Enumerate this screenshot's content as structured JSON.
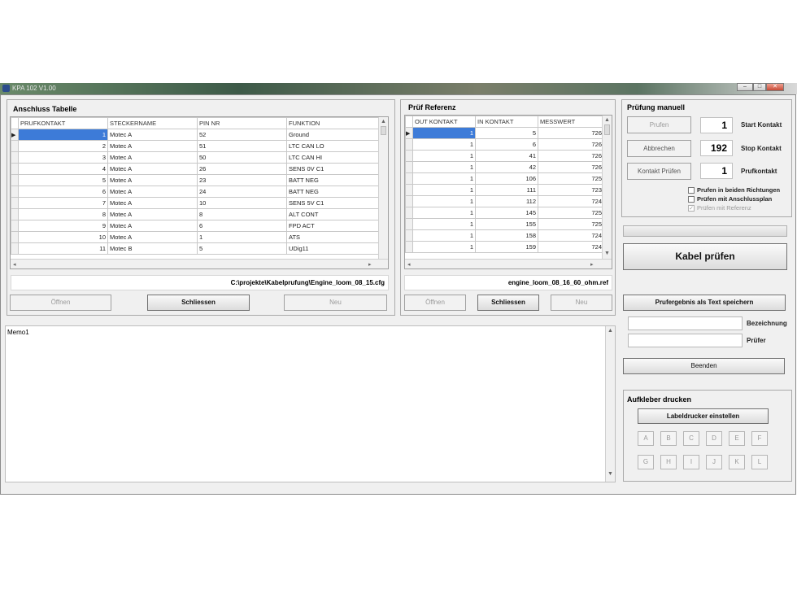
{
  "window": {
    "title": "KPA 102   V1.00",
    "controls": [
      "–",
      "□",
      "✕"
    ]
  },
  "anschluss": {
    "title": "Anschluss Tabelle",
    "columns": [
      "PRUFKONTAKT",
      "STECKERNAME",
      "PIN NR",
      "FUNKTION"
    ],
    "rows": [
      [
        "1",
        "Motec A",
        "52",
        "Ground"
      ],
      [
        "2",
        "Motec A",
        "51",
        "LTC CAN LO"
      ],
      [
        "3",
        "Motec A",
        "50",
        "LTC CAN HI"
      ],
      [
        "4",
        "Motec A",
        "26",
        "SENS 0V C1"
      ],
      [
        "5",
        "Motec A",
        "23",
        "BATT NEG"
      ],
      [
        "6",
        "Motec A",
        "24",
        "BATT NEG"
      ],
      [
        "7",
        "Motec A",
        "10",
        "SENS 5V C1"
      ],
      [
        "8",
        "Motec A",
        "8",
        "ALT CONT"
      ],
      [
        "9",
        "Motec A",
        "6",
        "FPD ACT"
      ],
      [
        "10",
        "Motec A",
        "1",
        "ATS"
      ],
      [
        "11",
        "Motec B",
        "5",
        "UDig11"
      ]
    ],
    "path": "C:\\projekte\\Kabelprufung\\Engine_loom_08_15.cfg",
    "buttons": {
      "open": "Öffnen",
      "close": "Schliessen",
      "new": "Neu"
    }
  },
  "referenz": {
    "title": "Prüf Referenz",
    "columns": [
      "OUT KONTAKT",
      "IN KONTAKT",
      "MESSWERT"
    ],
    "rows": [
      [
        "1",
        "5",
        "726"
      ],
      [
        "1",
        "6",
        "726"
      ],
      [
        "1",
        "41",
        "726"
      ],
      [
        "1",
        "42",
        "726"
      ],
      [
        "1",
        "106",
        "725"
      ],
      [
        "1",
        "111",
        "723"
      ],
      [
        "1",
        "112",
        "724"
      ],
      [
        "1",
        "145",
        "725"
      ],
      [
        "1",
        "155",
        "725"
      ],
      [
        "1",
        "158",
        "724"
      ],
      [
        "1",
        "159",
        "724"
      ]
    ],
    "path": "engine_loom_08_16_60_ohm.ref",
    "buttons": {
      "open": "Öffnen",
      "close": "Schliessen",
      "new": "Neu"
    }
  },
  "manuell": {
    "title": "Prüfung manuell",
    "pruefen_btn": "Prufen",
    "abbrechen_btn": "Abbrechen",
    "kontakt_btn": "Kontakt Prüfen",
    "start_value": "1",
    "stop_value": "192",
    "prufkontakt_value": "1",
    "start_label": "Start Kontakt",
    "stop_label": "Stop Kontakt",
    "prufkontakt_label": "Prufkontakt",
    "check1": "Prufen in beiden Richtungen",
    "check2": "Prüfen mit Anschlussplan",
    "check3": "Prüfen mit Referenz"
  },
  "kabel_btn": "Kabel prüfen",
  "save_text_btn": "Prufergebnis als Text speichern",
  "bezeichnung_label": "Bezeichnung",
  "pruefer_label": "Prüfer",
  "beenden_btn": "Beenden",
  "memo_text": "Memo1",
  "aufkleber": {
    "title": "Aufkleber drucken",
    "setup_btn": "Labeldrucker einstellen",
    "letters": [
      "A",
      "B",
      "C",
      "D",
      "E",
      "F",
      "G",
      "H",
      "I",
      "J",
      "K",
      "L"
    ]
  }
}
